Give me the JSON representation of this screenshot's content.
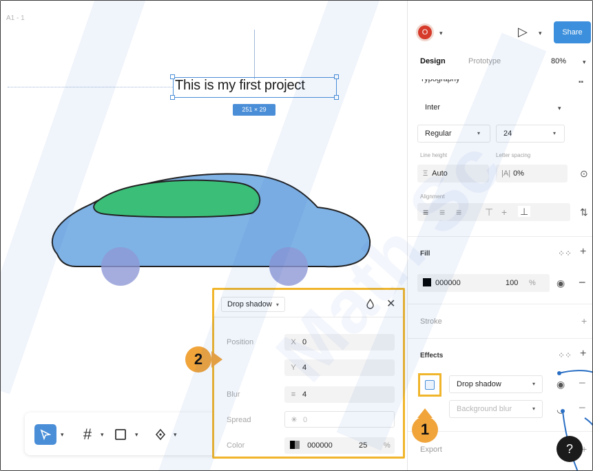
{
  "canvas": {
    "frame_label": "A1 - 1",
    "text_layer": "This is my first project",
    "dimension_badge": "251 × 29"
  },
  "colors": {
    "accent": "#4a8ed8",
    "share_button": "#3b8fdc",
    "callout": "#f0a43a",
    "highlight_border": "#f0b52a",
    "car_body": "#7fb2e5",
    "car_window": "#3bbf78",
    "car_wheel": "#8f98d6"
  },
  "toolbar": {
    "tools": [
      "select-tool",
      "frame-tool",
      "shape-tool",
      "pen-tool"
    ]
  },
  "drop_shadow_panel": {
    "type_label": "Drop shadow",
    "position_label": "Position",
    "x_prefix": "X",
    "x_value": "0",
    "y_prefix": "Y",
    "y_value": "4",
    "blur_label": "Blur",
    "blur_value": "4",
    "spread_label": "Spread",
    "spread_value": "0",
    "color_label": "Color",
    "color_hex": "000000",
    "color_opacity": "25",
    "color_pct": "%"
  },
  "callouts": {
    "one": "1",
    "two": "2"
  },
  "panel": {
    "avatar_letter": "O",
    "share_label": "Share",
    "tabs": {
      "design": "Design",
      "prototype": "Prototype"
    },
    "zoom": "80%",
    "typography_label": "Typography",
    "font_family": "Inter",
    "font_weight": "Regular",
    "font_size": "24",
    "line_height_label": "Line height",
    "letter_spacing_label": "Letter spacing",
    "line_height_value": "Auto",
    "letter_spacing_value": "0%",
    "alignment_label": "Alignment",
    "fill_label": "Fill",
    "fill_hex": "000000",
    "fill_opacity": "100",
    "fill_pct": "%",
    "stroke_label": "Stroke",
    "effects_label": "Effects",
    "effect_1": "Drop shadow",
    "effect_2": "Background blur",
    "export_label": "Export"
  },
  "watermark_text": "Math Sc"
}
